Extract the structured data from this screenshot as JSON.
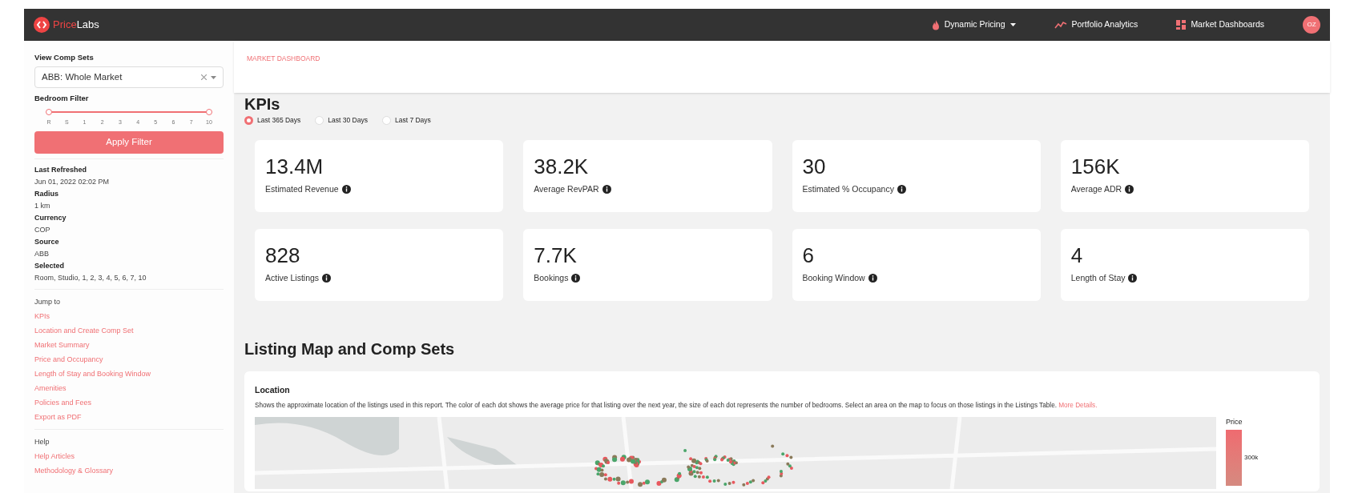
{
  "topbar": {
    "logo": {
      "part_1": "Price",
      "part_2": "Labs"
    },
    "nav": [
      {
        "label": "Dynamic Pricing",
        "kind": "dropdown"
      },
      {
        "label": "Portfolio Analytics",
        "kind": "chart"
      },
      {
        "label": "Market Dashboards",
        "kind": "grid"
      }
    ],
    "avatar": "OZ"
  },
  "sidebar": {
    "comp_sets_label": "View Comp Sets",
    "comp_set_value": "ABB: Whole Market",
    "bedroom_filter": {
      "label": "Bedroom Filter",
      "level": 1,
      "ticks": [
        "R",
        "S",
        "1",
        "2",
        "3",
        "4",
        "5",
        "6",
        "7",
        "10"
      ]
    },
    "apply_button": "Apply Filter",
    "info": [
      {
        "label": "Last Refreshed",
        "value": "Jun 01, 2022 02:02 PM"
      },
      {
        "label": "Radius",
        "value": "1 km"
      },
      {
        "label": "Currency",
        "value": "COP"
      },
      {
        "label": "Source",
        "value": "ABB"
      },
      {
        "label": "Selected",
        "value": "Room, Studio, 1, 2, 3, 4, 5, 6, 7, 10"
      }
    ],
    "jump_to": {
      "title": "Jump to",
      "links": [
        "KPIs",
        "Location and Create Comp Set",
        "Market Summary",
        "Price and Occupancy",
        "Length of Stay and Booking Window",
        "Amenities",
        "Policies and Fees",
        "Export as PDF"
      ]
    },
    "help": {
      "title": "Help",
      "links": [
        "Help Articles",
        "Methodology & Glossary"
      ]
    }
  },
  "breadcrumb": "MARKET DASHBOARD",
  "kpis": {
    "title": "KPIs",
    "periods": [
      {
        "label": "Last 365 Days",
        "selected": true
      },
      {
        "label": "Last 30 Days",
        "selected": false
      },
      {
        "label": "Last 7 Days",
        "selected": false
      }
    ],
    "cards": [
      {
        "value": "13.4M",
        "label": "Estimated Revenue"
      },
      {
        "value": "38.2K",
        "label": "Average RevPAR"
      },
      {
        "value": "30",
        "label": "Estimated % Occupancy"
      },
      {
        "value": "156K",
        "label": "Average ADR"
      },
      {
        "value": "828",
        "label": "Active Listings"
      },
      {
        "value": "7.7K",
        "label": "Bookings"
      },
      {
        "value": "6",
        "label": "Booking Window"
      },
      {
        "value": "4",
        "label": "Length of Stay"
      }
    ]
  },
  "map_section": {
    "title": "Listing Map and Comp Sets",
    "card_title": "Location",
    "description": "Shows the approximate location of the listings used in this report. The color of each dot shows the average price for that listing over the next year, the size of each dot represents the number of bedrooms. Select an area on the map to focus on those listings in the Listings Table.",
    "link": "More Details.",
    "legend": {
      "title": "Price",
      "tick": "300k"
    }
  }
}
